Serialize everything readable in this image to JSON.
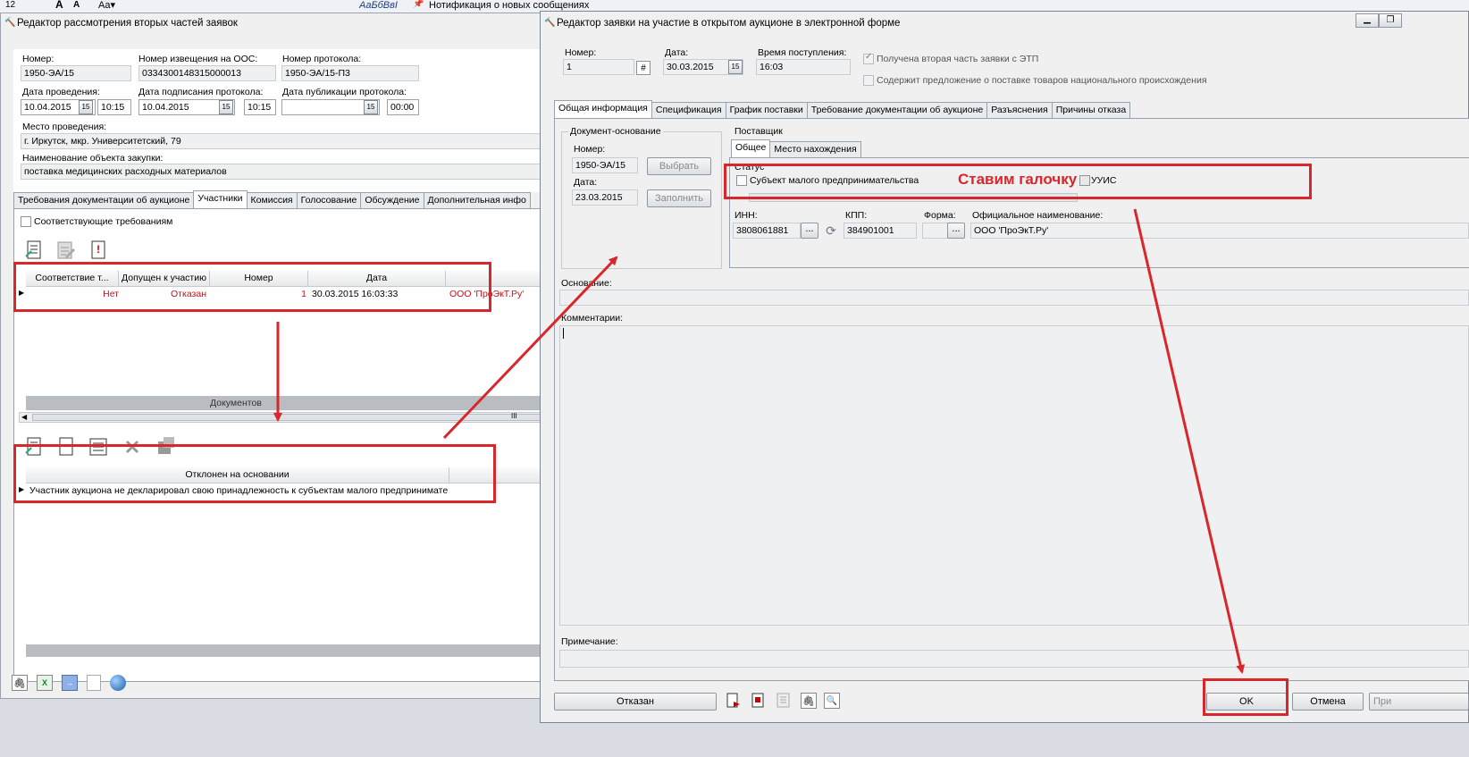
{
  "topbar": {
    "font_size": "12",
    "style_sample": "АаБбВвI",
    "notification": "Нотификация о новых сообщениях"
  },
  "left_window": {
    "title": "Редактор рассмотрения вторых частей заявок",
    "number_label": "Номер:",
    "number_value": "1950-ЭА/15",
    "notice_label": "Номер извещения на ООС:",
    "notice_value": "0334300148315000013",
    "protocol_label": "Номер протокола:",
    "protocol_value": "1950-ЭА/15-П3",
    "date_held_label": "Дата проведения:",
    "date_held_value": "10.04.2015",
    "time_held_value": "10:15",
    "sign_date_label": "Дата подписания протокола:",
    "sign_date_value": "10.04.2015",
    "sign_time_value": "10:15",
    "pub_date_label": "Дата публикации протокола:",
    "pub_date_value": "",
    "pub_time_value": "00:00",
    "place_label": "Место проведения:",
    "place_value": "г. Иркутск, мкр. Университетский, 79",
    "object_label": "Наименование объекта закупки:",
    "object_value": "поставка медицинских расходных материалов",
    "tabs": [
      "Требования документации об аукционе",
      "Участники",
      "Комиссия",
      "Голосование",
      "Обсуждение",
      "Дополнительная инфо"
    ],
    "active_tab": 1,
    "filter_checkbox_label": "Соответствующие требованиям",
    "participants_columns": [
      "Соответствие т...",
      "Допущен к участию",
      "Номер",
      "Дата"
    ],
    "participants_row": {
      "conformity": "Нет",
      "admitted": "Отказан",
      "number": "1",
      "date": "30.03.2015 16:03:33",
      "company": "ООО 'ПроЭкТ.Ру'"
    },
    "documents_header": "Документов",
    "scroll_mark": "III",
    "reasons_column": "Отклонен на основании",
    "reason_row": "Участник аукциона не декларировал свою принадлежность к субъектам малого предпринимате"
  },
  "right_window": {
    "title": "Редактор заявки на участие в открытом аукционе в электронной форме",
    "number_label": "Номер:",
    "number_value": "1",
    "date_label": "Дата:",
    "date_value": "30.03.2015",
    "time_label": "Время поступления:",
    "time_value": "16:03",
    "received_label": "Получена вторая часть заявки с ЭТП",
    "received_checked": true,
    "national_label": "Содержит предложение о поставке товаров национального происхождения",
    "national_checked": false,
    "tabs": [
      "Общая информация",
      "Спецификация",
      "График поставки",
      "Требование документации об аукционе",
      "Разъяснения",
      "Причины отказа"
    ],
    "active_tab": 0,
    "basis_doc": {
      "group_label": "Документ-основание",
      "number_label": "Номер:",
      "number_value": "1950-ЭА/15",
      "date_label": "Дата:",
      "date_value": "23.03.2015",
      "select_button": "Выбрать",
      "fill_button": "Заполнить"
    },
    "supplier": {
      "group_label": "Поставщик",
      "tabs": [
        "Общее",
        "Место нахождения"
      ],
      "active_tab": 0,
      "status_label": "Статус",
      "small_business_label": "Субъект малого предпринимательства",
      "small_business_checked": false,
      "uis_label": "УУИС",
      "inn_label": "ИНН:",
      "inn_value": "3808061881",
      "kpp_label": "КПП:",
      "kpp_value": "384901001",
      "form_label": "Форма:",
      "form_value": "",
      "name_label": "Официальное наименование:",
      "name_value": "ООО 'ПроЭкТ.Ру'",
      "ellipsis": "..."
    },
    "basis_label": "Основание:",
    "comments_label": "Комментарии:",
    "note_label": "Примечание:",
    "refused_button": "Отказан",
    "ok_button": "OK",
    "cancel_button": "Отмена",
    "apply_button": "При"
  },
  "annotation": {
    "text": "Ставим галочку",
    "color": "#d9262b"
  }
}
